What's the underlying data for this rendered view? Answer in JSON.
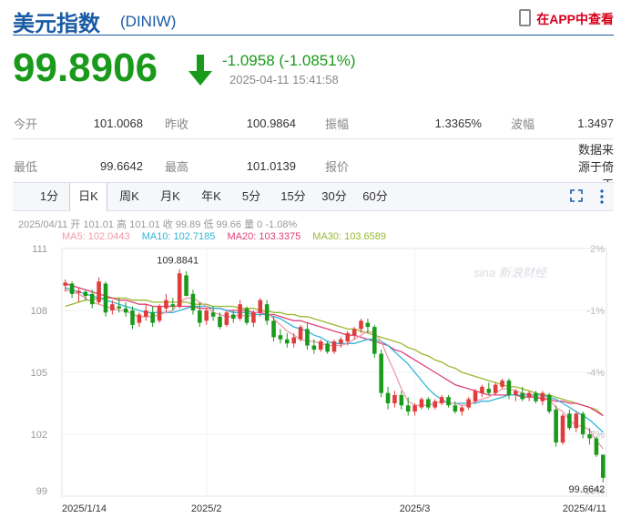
{
  "header": {
    "title": "美元指数",
    "code": "(DINIW)",
    "app_link": "在APP中查看",
    "app_icon": "phone-icon"
  },
  "quote": {
    "price": "99.8906",
    "change": "-1.0958 (-1.0851%)",
    "time": "2025-04-11 15:41:58",
    "direction_icon": "arrow-down-icon",
    "color_down": "#1a9a1a"
  },
  "stats": {
    "row1": [
      {
        "label": "今开",
        "value": "101.0068"
      },
      {
        "label": "昨收",
        "value": "100.9864"
      },
      {
        "label": "振幅",
        "value": "1.3365%"
      },
      {
        "label": "波幅",
        "value": "1.3497"
      }
    ],
    "row2": [
      {
        "label": "最低",
        "value": "99.6642"
      },
      {
        "label": "最高",
        "value": "101.0139"
      },
      {
        "label": "报价",
        "value": ""
      },
      {
        "label": "",
        "value": "数据来源于倚天"
      }
    ]
  },
  "tabs": [
    "1分",
    "日K",
    "周K",
    "月K",
    "年K",
    "5分",
    "15分",
    "30分",
    "60分"
  ],
  "active_tab": "日K",
  "info": {
    "line1": "2025/04/11 开 101.01 高 101.01 收 99.89 低 99.66 量 0 -1.08%",
    "ma5": "MA5: 102.0443",
    "ma10": "MA10: 102.7185",
    "ma20": "MA20: 103.3375",
    "ma30": "MA30: 103.6589"
  },
  "watermark": "sina 新浪财经",
  "chart_data": {
    "type": "candlestick",
    "ylim": [
      99,
      111
    ],
    "y_ticks_left": [
      "111",
      "108",
      "105",
      "102",
      "99"
    ],
    "y_ticks_right": [
      "2%",
      "-1%",
      "-4%",
      "-7%",
      "-10%"
    ],
    "x_ticks": [
      "2025/1/14",
      "2025/2",
      "2025/3",
      "2025/4/11"
    ],
    "annotations": {
      "high": "109.8841",
      "low": "99.6642"
    },
    "colors": {
      "up": "#e03c3c",
      "down": "#1a9a1a",
      "ma5": "#f09aaa",
      "ma10": "#31b5d8",
      "ma20": "#e0407a",
      "ma30": "#9ab830"
    },
    "candles": [
      [
        109.2,
        109.5,
        108.9,
        109.35
      ],
      [
        109.3,
        109.4,
        108.6,
        108.8
      ],
      [
        108.85,
        109.1,
        108.4,
        108.95
      ],
      [
        108.9,
        109.0,
        108.5,
        108.7
      ],
      [
        108.8,
        109.0,
        108.1,
        108.3
      ],
      [
        108.4,
        109.6,
        108.3,
        109.4
      ],
      [
        109.3,
        109.4,
        107.7,
        107.9
      ],
      [
        108.0,
        108.5,
        107.8,
        108.3
      ],
      [
        108.2,
        108.6,
        107.9,
        108.1
      ],
      [
        108.1,
        108.4,
        107.7,
        107.9
      ],
      [
        108.0,
        108.2,
        107.1,
        107.3
      ],
      [
        107.4,
        107.9,
        107.2,
        107.8
      ],
      [
        107.7,
        108.3,
        107.5,
        108.0
      ],
      [
        107.9,
        108.2,
        107.2,
        107.4
      ],
      [
        107.5,
        108.3,
        107.4,
        108.2
      ],
      [
        108.1,
        108.8,
        107.9,
        108.5
      ],
      [
        108.3,
        108.6,
        108.0,
        108.2
      ],
      [
        108.2,
        110.0,
        108.1,
        109.8
      ],
      [
        109.7,
        109.9,
        108.9,
        108.7
      ],
      [
        108.8,
        109.0,
        107.8,
        108.0
      ],
      [
        108.0,
        108.4,
        107.2,
        107.4
      ],
      [
        107.5,
        108.1,
        107.3,
        108.0
      ],
      [
        107.9,
        108.2,
        107.5,
        107.7
      ],
      [
        107.7,
        107.9,
        107.1,
        107.2
      ],
      [
        107.3,
        108.0,
        107.2,
        107.9
      ],
      [
        107.8,
        108.0,
        107.4,
        107.6
      ],
      [
        107.6,
        108.5,
        107.5,
        108.3
      ],
      [
        108.1,
        108.2,
        107.3,
        107.4
      ],
      [
        107.4,
        108.0,
        107.2,
        107.9
      ],
      [
        107.9,
        108.6,
        107.7,
        108.5
      ],
      [
        108.3,
        108.5,
        107.3,
        107.5
      ],
      [
        107.5,
        107.7,
        106.5,
        106.7
      ],
      [
        106.8,
        107.1,
        106.4,
        106.6
      ],
      [
        106.6,
        106.9,
        106.2,
        106.4
      ],
      [
        106.4,
        106.9,
        106.2,
        106.7
      ],
      [
        106.6,
        107.3,
        106.5,
        107.2
      ],
      [
        107.1,
        107.4,
        106.1,
        106.3
      ],
      [
        106.3,
        106.6,
        105.9,
        106.1
      ],
      [
        106.1,
        106.6,
        106.0,
        106.5
      ],
      [
        106.4,
        106.5,
        105.9,
        106.0
      ],
      [
        106.0,
        106.6,
        105.9,
        106.5
      ],
      [
        106.4,
        106.7,
        106.2,
        106.6
      ],
      [
        106.5,
        107.0,
        106.3,
        106.9
      ],
      [
        106.8,
        107.2,
        106.6,
        107.1
      ],
      [
        107.1,
        107.6,
        106.9,
        107.5
      ],
      [
        107.4,
        107.6,
        106.9,
        107.2
      ],
      [
        107.2,
        107.3,
        105.7,
        105.9
      ],
      [
        105.9,
        106.1,
        103.8,
        104.0
      ],
      [
        104.0,
        104.3,
        103.2,
        103.5
      ],
      [
        103.5,
        104.1,
        103.3,
        103.9
      ],
      [
        103.9,
        104.1,
        103.2,
        103.4
      ],
      [
        103.4,
        103.8,
        102.9,
        103.1
      ],
      [
        103.1,
        103.5,
        102.9,
        103.4
      ],
      [
        103.3,
        103.8,
        103.2,
        103.7
      ],
      [
        103.7,
        103.8,
        103.2,
        103.3
      ],
      [
        103.3,
        103.7,
        103.2,
        103.6
      ],
      [
        103.5,
        103.9,
        103.4,
        103.8
      ],
      [
        103.8,
        103.9,
        103.3,
        103.4
      ],
      [
        103.4,
        103.6,
        103.0,
        103.1
      ],
      [
        103.1,
        103.4,
        102.9,
        103.3
      ],
      [
        103.3,
        103.8,
        103.2,
        103.7
      ],
      [
        103.6,
        104.2,
        103.5,
        104.1
      ],
      [
        104.0,
        104.4,
        103.8,
        104.3
      ],
      [
        104.2,
        104.5,
        103.9,
        104.0
      ],
      [
        104.0,
        104.5,
        103.9,
        104.4
      ],
      [
        104.3,
        104.7,
        104.2,
        104.6
      ],
      [
        104.6,
        104.7,
        103.7,
        103.9
      ],
      [
        103.9,
        104.2,
        103.6,
        104.1
      ],
      [
        104.0,
        104.3,
        103.6,
        103.7
      ],
      [
        103.8,
        104.1,
        103.6,
        104.0
      ],
      [
        104.0,
        104.1,
        103.5,
        103.6
      ],
      [
        103.6,
        104.1,
        103.4,
        104.0
      ],
      [
        103.9,
        104.0,
        103.0,
        103.1
      ],
      [
        103.2,
        103.4,
        101.4,
        101.6
      ],
      [
        101.6,
        103.0,
        101.5,
        102.9
      ],
      [
        103.0,
        103.2,
        102.2,
        102.3
      ],
      [
        102.3,
        103.1,
        102.1,
        103.0
      ],
      [
        103.0,
        103.1,
        101.8,
        102.0
      ],
      [
        102.0,
        102.3,
        101.5,
        101.8
      ],
      [
        101.8,
        101.9,
        100.9,
        101.0
      ],
      [
        101.01,
        101.01,
        99.66,
        99.89
      ]
    ],
    "ma5": [
      109.0,
      108.9,
      108.8,
      108.6,
      108.4,
      108.3,
      108.2,
      108.1,
      108.0,
      108.0,
      107.8,
      107.7,
      107.7,
      107.7,
      107.8,
      107.9,
      108.0,
      108.4,
      108.6,
      108.6,
      108.4,
      108.2,
      107.9,
      107.8,
      107.7,
      107.7,
      107.8,
      107.7,
      107.8,
      108.0,
      107.9,
      107.6,
      107.3,
      107.0,
      106.8,
      106.6,
      106.5,
      106.5,
      106.4,
      106.3,
      106.3,
      106.3,
      106.4,
      106.6,
      106.8,
      107.0,
      106.9,
      106.5,
      105.7,
      105.0,
      104.2,
      103.6,
      103.4,
      103.4,
      103.4,
      103.5,
      103.6,
      103.5,
      103.5,
      103.4,
      103.4,
      103.6,
      103.7,
      103.8,
      104.0,
      104.2,
      104.2,
      104.1,
      104.0,
      103.9,
      103.8,
      103.8,
      103.7,
      103.3,
      103.1,
      102.7,
      102.4,
      102.4,
      102.2,
      101.7,
      101.3
    ],
    "ma10": [
      109.1,
      109.0,
      108.9,
      108.8,
      108.7,
      108.6,
      108.5,
      108.4,
      108.3,
      108.2,
      108.1,
      108.0,
      107.9,
      107.9,
      107.9,
      107.9,
      107.9,
      108.0,
      108.1,
      108.2,
      108.2,
      108.2,
      108.1,
      108.1,
      108.0,
      107.9,
      107.9,
      107.9,
      107.8,
      107.8,
      107.8,
      107.7,
      107.6,
      107.4,
      107.2,
      107.1,
      107.0,
      106.8,
      106.7,
      106.5,
      106.4,
      106.4,
      106.4,
      106.4,
      106.5,
      106.6,
      106.6,
      106.5,
      106.3,
      106.0,
      105.7,
      105.4,
      105.0,
      104.6,
      104.2,
      103.9,
      103.7,
      103.5,
      103.5,
      103.5,
      103.5,
      103.5,
      103.6,
      103.6,
      103.7,
      103.8,
      103.9,
      103.9,
      103.9,
      103.9,
      103.9,
      103.9,
      103.8,
      103.7,
      103.5,
      103.3,
      103.1,
      102.9,
      102.7,
      102.4,
      102.1
    ],
    "ma20": [
      109.3,
      109.2,
      109.1,
      109.0,
      108.9,
      108.8,
      108.7,
      108.6,
      108.5,
      108.5,
      108.4,
      108.3,
      108.3,
      108.2,
      108.2,
      108.2,
      108.2,
      108.2,
      108.2,
      108.2,
      108.1,
      108.1,
      108.1,
      108.1,
      108.0,
      108.0,
      108.0,
      108.0,
      107.9,
      107.9,
      107.8,
      107.8,
      107.7,
      107.6,
      107.5,
      107.5,
      107.4,
      107.3,
      107.2,
      107.1,
      107.0,
      106.9,
      106.8,
      106.8,
      106.7,
      106.6,
      106.5,
      106.4,
      106.3,
      106.1,
      106.0,
      105.8,
      105.6,
      105.4,
      105.2,
      105.0,
      104.8,
      104.6,
      104.4,
      104.3,
      104.2,
      104.1,
      104.0,
      103.9,
      103.9,
      103.9,
      103.9,
      103.9,
      103.8,
      103.8,
      103.8,
      103.7,
      103.7,
      103.6,
      103.6,
      103.5,
      103.5,
      103.4,
      103.3,
      103.1,
      102.9
    ],
    "ma30": [
      108.2,
      108.3,
      108.4,
      108.5,
      108.5,
      108.6,
      108.6,
      108.6,
      108.6,
      108.6,
      108.5,
      108.5,
      108.5,
      108.4,
      108.4,
      108.4,
      108.4,
      108.4,
      108.4,
      108.3,
      108.3,
      108.3,
      108.2,
      108.2,
      108.2,
      108.2,
      108.1,
      108.1,
      108.1,
      108.0,
      108.0,
      107.9,
      107.9,
      107.8,
      107.8,
      107.7,
      107.7,
      107.6,
      107.5,
      107.4,
      107.3,
      107.2,
      107.1,
      107.1,
      107.0,
      106.9,
      106.8,
      106.7,
      106.6,
      106.5,
      106.4,
      106.2,
      106.1,
      105.9,
      105.8,
      105.6,
      105.5,
      105.3,
      105.2,
      105.0,
      104.9,
      104.8,
      104.7,
      104.6,
      104.5,
      104.4,
      104.3,
      104.3,
      104.2,
      104.1,
      104.0,
      103.9,
      103.9,
      103.8,
      103.7,
      103.6,
      103.5,
      103.4,
      103.3,
      103.2,
      102.9
    ]
  }
}
